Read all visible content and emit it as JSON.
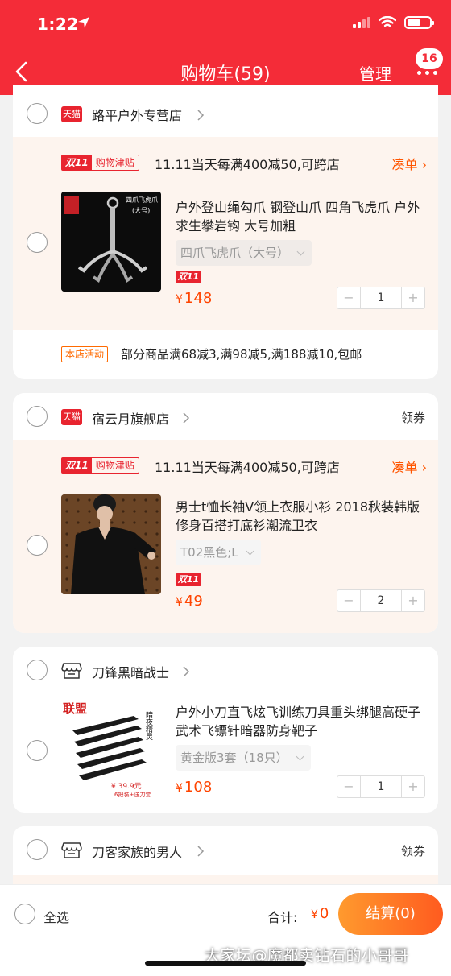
{
  "status_bar": {
    "time": "1:22"
  },
  "header": {
    "title": "购物车(59)",
    "manage": "管理",
    "badge": "16"
  },
  "tags": {
    "double11": "双11",
    "allowance": "购物津贴",
    "store_activity": "本店活动",
    "tmall": "天猫"
  },
  "shops": [
    {
      "name": "路平户外专营店",
      "promo": {
        "text": "11.11当天每满400减50,可跨店",
        "link": "凑单"
      },
      "item": {
        "title": "户外登山绳勾爪 钢登山爪 四角飞虎爪 户外求生攀岩钩 大号加粗",
        "sku": "四爪飞虎爪（大号）",
        "price": "148",
        "qty": "1",
        "thumb_caption": "四爪飞虎爪",
        "thumb_sub": "(大号)"
      },
      "activity": "部分商品满68减3,满98减5,满188减10,包邮"
    },
    {
      "name": "宿云月旗舰店",
      "coupon": "领券",
      "promo": {
        "text": "11.11当天每满400减50,可跨店",
        "link": "凑单"
      },
      "item": {
        "title": "男士t恤长袖V领上衣服小衫 2018秋装韩版修身百搭打底衫潮流卫衣",
        "sku": "T02黑色;L",
        "price": "49",
        "qty": "2"
      }
    },
    {
      "name": "刀锋黑暗战士",
      "item": {
        "title": "户外小刀直飞炫飞训练刀具重头绑腿高硬子武术飞镖针暗器防身靶子",
        "sku": "黄金版3套（18只）",
        "price": "108",
        "qty": "1",
        "thumb_top": "联盟",
        "thumb_side": "暗夜精灵",
        "thumb_price": "¥ 39.9元",
        "thumb_note": "6把装+送刀套"
      }
    },
    {
      "name": "刀客家族的男人",
      "coupon": "领券"
    }
  ],
  "bottom": {
    "select_all": "全选",
    "total_label": "合计:",
    "currency": "¥",
    "total": "0",
    "checkout": "结算(0)"
  },
  "currency_symbol": "¥",
  "watermark": "大家坛@魔都卖钻石的小哥哥",
  "colors": {
    "header_red": "#f42c38",
    "price_orange": "#ff4400",
    "checkout_start": "#ff9a2e",
    "checkout_end": "#ff5b1f",
    "promo_bg": "#fdf4ee"
  }
}
